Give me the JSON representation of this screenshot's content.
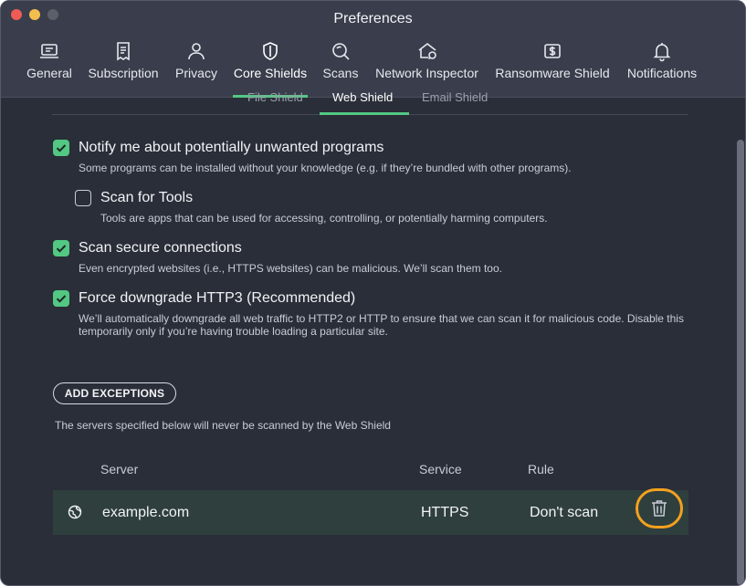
{
  "window": {
    "title": "Preferences"
  },
  "tabs": [
    {
      "label": "General",
      "icon": "laptop-icon"
    },
    {
      "label": "Subscription",
      "icon": "receipt-icon"
    },
    {
      "label": "Privacy",
      "icon": "person-icon"
    },
    {
      "label": "Core Shields",
      "icon": "shield-icon"
    },
    {
      "label": "Scans",
      "icon": "magnifier-icon"
    },
    {
      "label": "Network Inspector",
      "icon": "home-network-icon"
    },
    {
      "label": "Ransomware Shield",
      "icon": "dollar-shield-icon"
    },
    {
      "label": "Notifications",
      "icon": "bell-icon"
    }
  ],
  "active_tab": "Core Shields",
  "subtabs": [
    "File Shield",
    "Web Shield",
    "Email Shield"
  ],
  "active_subtab": "Web Shield",
  "options": [
    {
      "title": "Notify me about potentially unwanted programs",
      "desc": "Some programs can be installed without your knowledge (e.g. if they’re bundled with other programs).",
      "checked": true
    },
    {
      "title": "Scan for Tools",
      "desc": "Tools are apps that can be used for accessing, controlling, or potentially harming computers.",
      "checked": false
    },
    {
      "title": "Scan secure connections",
      "desc": "Even encrypted websites (i.e., HTTPS websites) can be malicious. We’ll scan them too.",
      "checked": true
    },
    {
      "title": "Force downgrade HTTP3 (Recommended)",
      "desc_line1": "We’ll automatically downgrade all web traffic to HTTP2 or HTTP to ensure that we can scan it for malicious code. Disable this",
      "desc_line2": "temporarily only if you’re having trouble loading a particular site.",
      "checked": true
    }
  ],
  "exceptions": {
    "button_label": "ADD EXCEPTIONS",
    "note": "The servers specified below will never be scanned by the Web Shield",
    "columns": {
      "server": "Server",
      "service": "Service",
      "rule": "Rule"
    },
    "rows": [
      {
        "server": "example.com",
        "service": "HTTPS",
        "rule": "Don't scan"
      }
    ]
  },
  "colors": {
    "accent": "#52c883",
    "highlight": "#f3a11e",
    "background": "#2a2e38"
  }
}
